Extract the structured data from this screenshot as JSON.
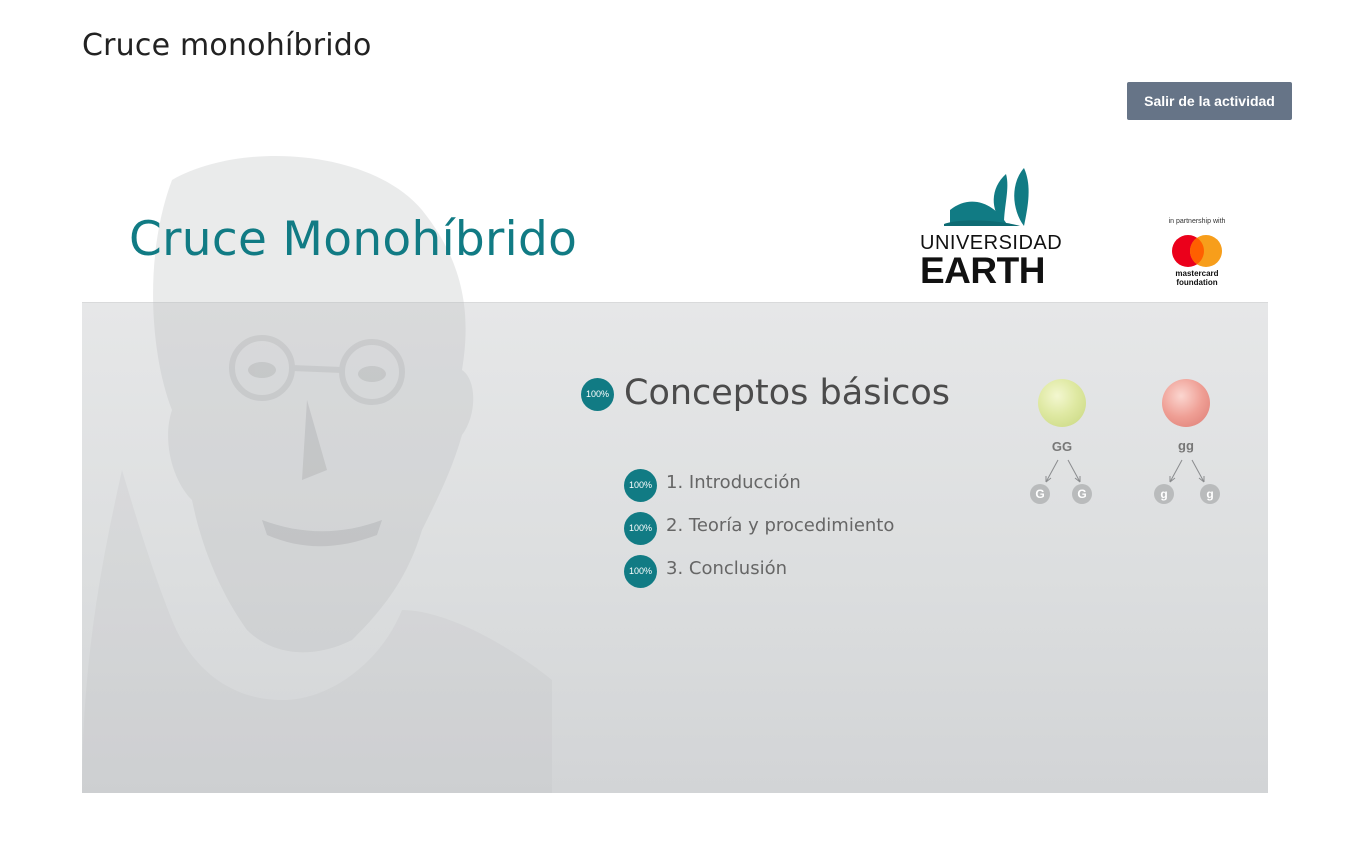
{
  "page": {
    "title": "Cruce monohíbrido"
  },
  "toolbar": {
    "exit_label": "Salir de la actividad"
  },
  "activity": {
    "title": "Cruce Monohíbrido",
    "logos": {
      "university": {
        "line1": "UNIVERSIDAD",
        "line2": "EARTH"
      },
      "partner": {
        "prefix": "in partnership with",
        "name_line1": "mastercard",
        "name_line2": "foundation"
      }
    },
    "section": {
      "progress": "100%",
      "title": "Conceptos básicos",
      "items": [
        {
          "progress": "100%",
          "label": "1. Introducción"
        },
        {
          "progress": "100%",
          "label": "2. Teoría y procedimiento"
        },
        {
          "progress": "100%",
          "label": "3. Conclusión"
        }
      ]
    },
    "diagram": {
      "left": {
        "genotype": "GG",
        "alleles": [
          "G",
          "G"
        ]
      },
      "right": {
        "genotype": "gg",
        "alleles": [
          "g",
          "g"
        ]
      }
    }
  },
  "colors": {
    "accent": "#117b84",
    "button": "#667487"
  }
}
